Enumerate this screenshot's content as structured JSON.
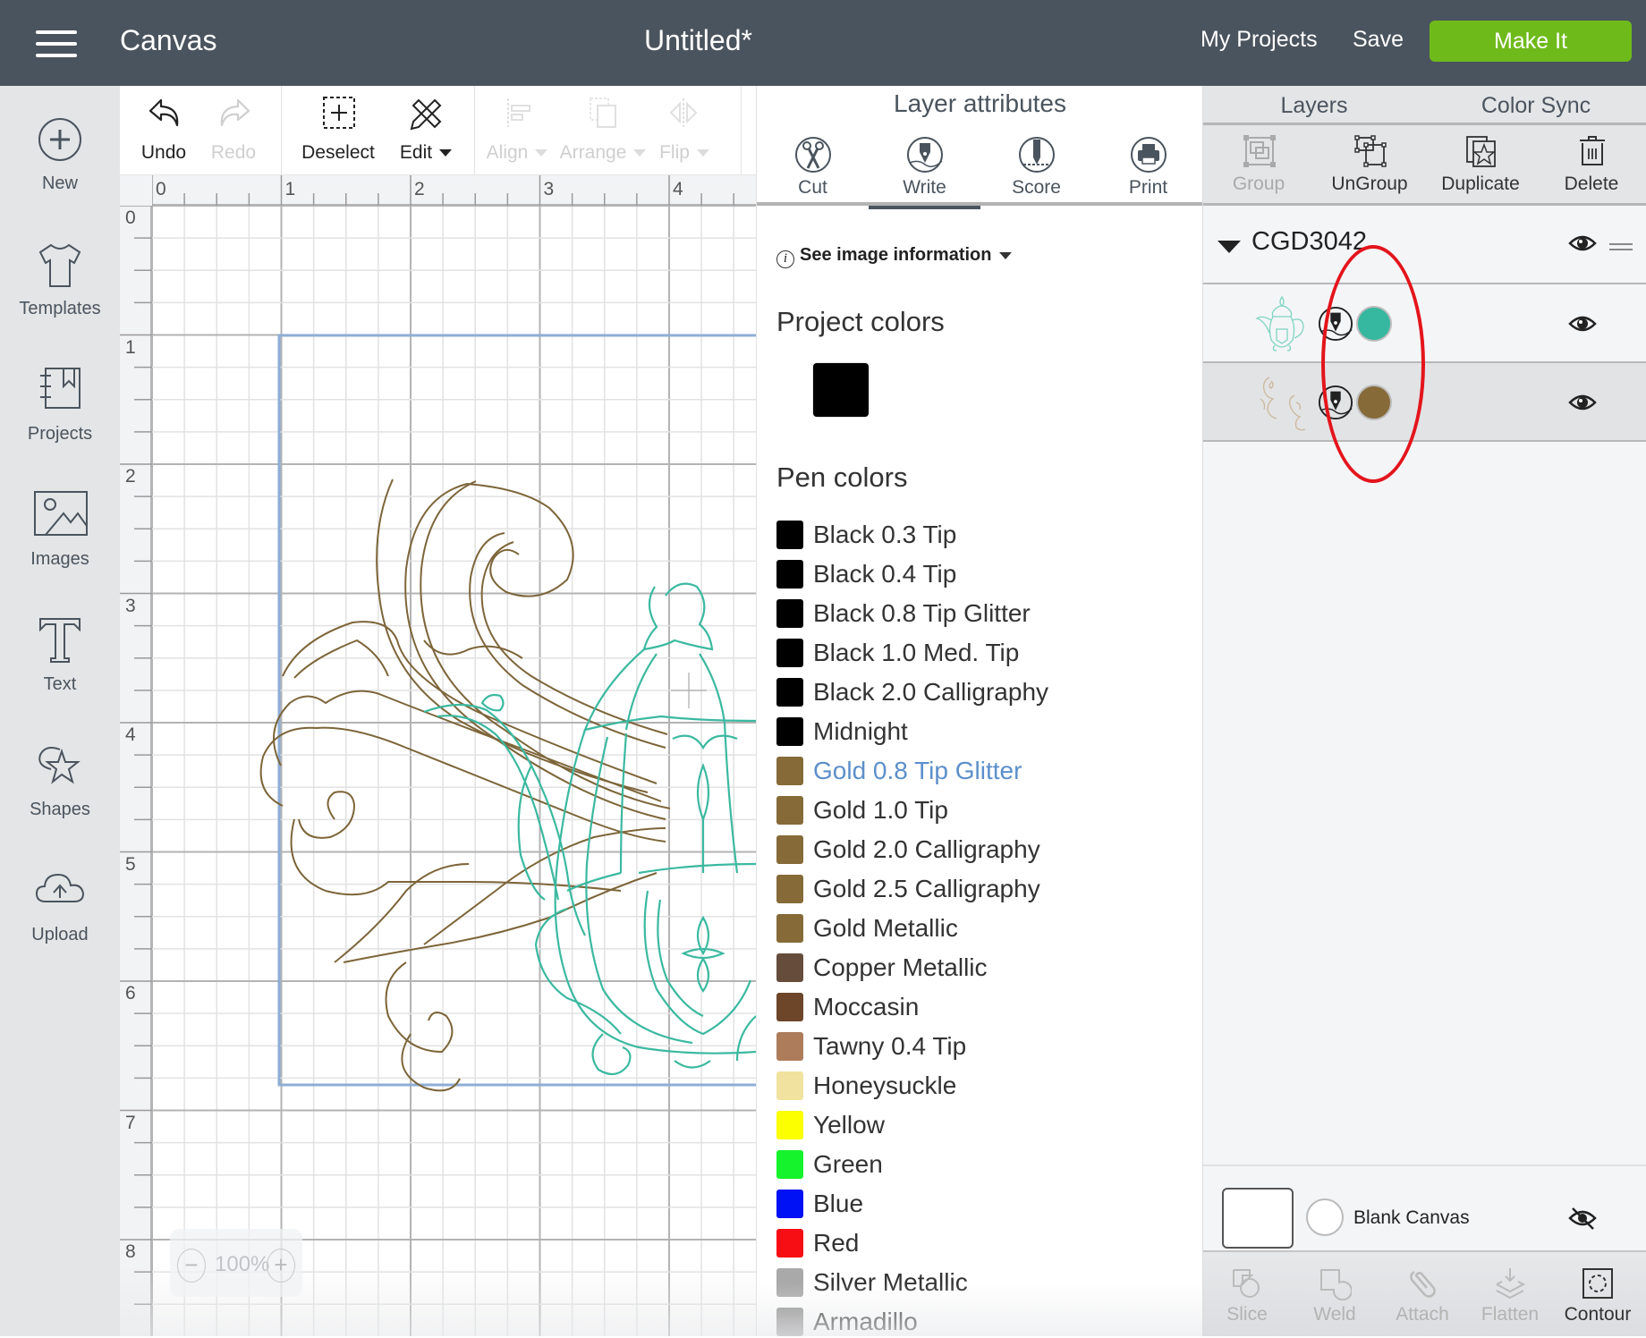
{
  "header": {
    "app_title": "Canvas",
    "document_title": "Untitled*",
    "my_projects": "My Projects",
    "save": "Save",
    "make_it": "Make It"
  },
  "sidebar": {
    "items": [
      {
        "label": "New",
        "icon": "plus-circle-icon"
      },
      {
        "label": "Templates",
        "icon": "tshirt-icon"
      },
      {
        "label": "Projects",
        "icon": "notebook-icon"
      },
      {
        "label": "Images",
        "icon": "image-icon"
      },
      {
        "label": "Text",
        "icon": "text-icon"
      },
      {
        "label": "Shapes",
        "icon": "shapes-icon"
      },
      {
        "label": "Upload",
        "icon": "upload-cloud-icon"
      }
    ]
  },
  "toolbar": {
    "undo": "Undo",
    "redo": "Redo",
    "deselect": "Deselect",
    "edit": "Edit",
    "align": "Align",
    "arrange": "Arrange",
    "flip": "Flip"
  },
  "canvas": {
    "ruler_x": [
      "0",
      "1",
      "2",
      "3",
      "4"
    ],
    "ruler_y": [
      "0",
      "1",
      "2",
      "3",
      "4",
      "5",
      "6",
      "7",
      "8"
    ],
    "zoom_level": "100%",
    "zoom_out": "−",
    "zoom_in": "+",
    "layer_colors": {
      "teapot": "#3bb9a0",
      "flourish": "#7d6539"
    }
  },
  "attributes": {
    "title": "Layer attributes",
    "tabs": [
      {
        "label": "Cut",
        "icon": "scissors-icon"
      },
      {
        "label": "Write",
        "icon": "pen-nib-icon",
        "active": true
      },
      {
        "label": "Score",
        "icon": "score-stylus-icon"
      },
      {
        "label": "Print",
        "icon": "printer-icon"
      }
    ],
    "image_info": "See image information",
    "project_colors_heading": "Project colors",
    "project_colors": [
      "#000000"
    ],
    "pen_colors_heading": "Pen colors",
    "pen_colors": [
      {
        "name": "Black 0.3 Tip",
        "color": "#000000"
      },
      {
        "name": "Black 0.4 Tip",
        "color": "#000000"
      },
      {
        "name": "Black 0.8 Tip Glitter",
        "color": "#000000"
      },
      {
        "name": "Black 1.0 Med. Tip",
        "color": "#000000"
      },
      {
        "name": "Black 2.0 Calligraphy",
        "color": "#000000"
      },
      {
        "name": "Midnight",
        "color": "#000000"
      },
      {
        "name": "Gold 0.8 Tip Glitter",
        "color": "#866a38",
        "selected": true
      },
      {
        "name": "Gold 1.0 Tip",
        "color": "#866a38"
      },
      {
        "name": "Gold 2.0 Calligraphy",
        "color": "#866a38"
      },
      {
        "name": "Gold 2.5 Calligraphy",
        "color": "#866a38"
      },
      {
        "name": "Gold Metallic",
        "color": "#866a38"
      },
      {
        "name": "Copper Metallic",
        "color": "#654c3b"
      },
      {
        "name": "Moccasin",
        "color": "#6d4529"
      },
      {
        "name": "Tawny 0.4 Tip",
        "color": "#ad7c5b"
      },
      {
        "name": "Honeysuckle",
        "color": "#f1e39f"
      },
      {
        "name": "Yellow",
        "color": "#fcff00"
      },
      {
        "name": "Green",
        "color": "#14f32b"
      },
      {
        "name": "Blue",
        "color": "#0011f5"
      },
      {
        "name": "Red",
        "color": "#f70d14"
      },
      {
        "name": "Silver Metallic",
        "color": "#a9a9a9"
      },
      {
        "name": "Armadillo",
        "color": "#8e8e8e"
      }
    ]
  },
  "layers": {
    "tabs": [
      {
        "label": "Layers",
        "active": true
      },
      {
        "label": "Color Sync"
      }
    ],
    "tools": [
      {
        "label": "Group",
        "disabled": true
      },
      {
        "label": "UnGroup"
      },
      {
        "label": "Duplicate"
      },
      {
        "label": "Delete"
      }
    ],
    "group_name": "CGD3042",
    "rows": [
      {
        "thumbnail": "teapot",
        "operation": "write",
        "color": "#36b79f",
        "visible": true
      },
      {
        "thumbnail": "flourish",
        "operation": "write",
        "color": "#866a38",
        "visible": true,
        "selected": true
      }
    ],
    "blank_canvas": "Blank Canvas",
    "bottom_tools": [
      {
        "label": "Slice",
        "enabled": false
      },
      {
        "label": "Weld",
        "enabled": false
      },
      {
        "label": "Attach",
        "enabled": false
      },
      {
        "label": "Flatten",
        "enabled": false
      },
      {
        "label": "Contour",
        "enabled": true
      }
    ]
  },
  "annotation": {
    "color": "#e4141b",
    "shape": "ellipse"
  }
}
